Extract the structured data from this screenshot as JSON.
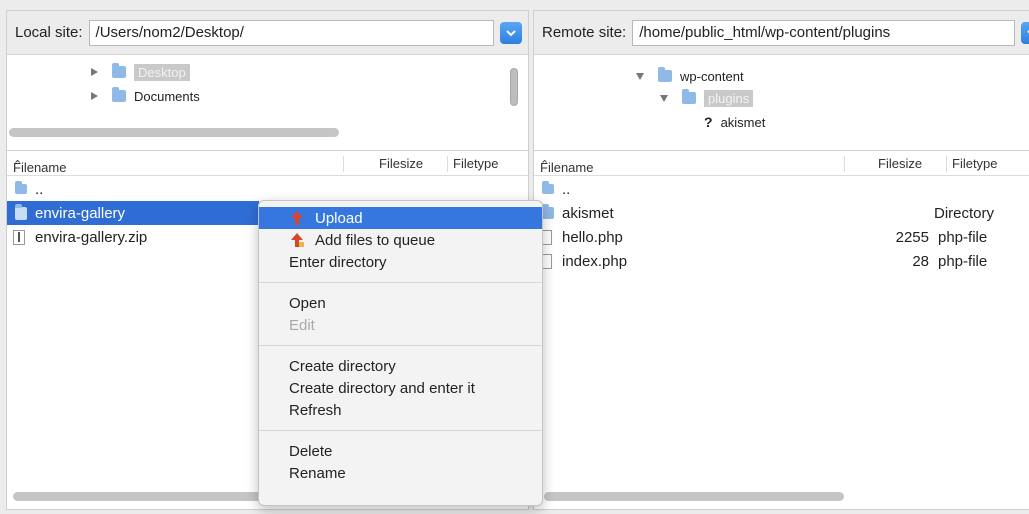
{
  "local": {
    "label": "Local site:",
    "path": "/Users/nom2/Desktop/",
    "tree": [
      {
        "label": "Desktop",
        "selected": true
      },
      {
        "label": "Documents",
        "selected": false
      }
    ],
    "headers": {
      "filename": "Filename",
      "filesize": "Filesize",
      "filetype": "Filetype"
    },
    "files": [
      {
        "name": ".."
      },
      {
        "name": "envira-gallery"
      },
      {
        "name": "envira-gallery.zip"
      }
    ]
  },
  "remote": {
    "label": "Remote site:",
    "path": "/home/public_html/wp-content/plugins",
    "tree": [
      {
        "label": "wp-content",
        "selected": false
      },
      {
        "label": "plugins",
        "selected": true
      },
      {
        "label": "akismet",
        "selected": false
      }
    ],
    "headers": {
      "filename": "Filename",
      "filesize": "Filesize",
      "filetype": "Filetype"
    },
    "files": [
      {
        "name": "..",
        "size": "",
        "type": ""
      },
      {
        "name": "akismet",
        "size": "",
        "type": "Directory"
      },
      {
        "name": "hello.php",
        "size": "2255",
        "type": "php-file"
      },
      {
        "name": "index.php",
        "size": "28",
        "type": "php-file"
      }
    ]
  },
  "context_menu": {
    "upload": "Upload",
    "add_to_queue": "Add files to queue",
    "enter_directory": "Enter directory",
    "open": "Open",
    "edit": "Edit",
    "create_directory": "Create directory",
    "create_directory_enter": "Create directory and enter it",
    "refresh": "Refresh",
    "delete": "Delete",
    "rename": "Rename"
  },
  "colors": {
    "selection": "#2f6dd5",
    "menu_highlight": "#3577de",
    "upload_arrow": "#d9452b"
  },
  "sort_indicator": "^"
}
